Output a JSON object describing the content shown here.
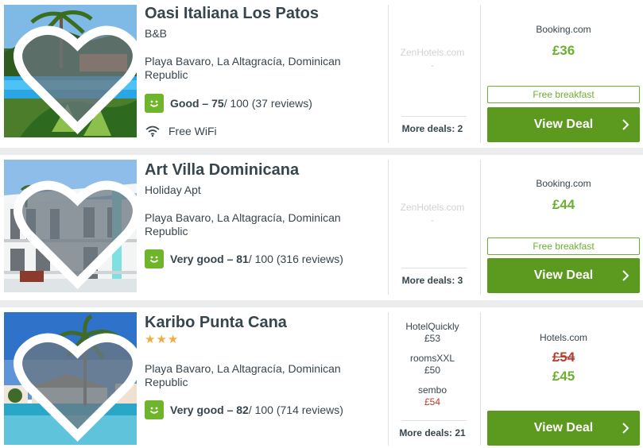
{
  "hotels": [
    {
      "name": "Oasi Italiana Los Patos",
      "type": "B&B",
      "stars": "",
      "address": "Playa Bavaro, La Altagracía, Dominican Republic",
      "rating_label": "Good – 75",
      "rating_rest": " / 100 (37 reviews)",
      "amenity": "Free WiFi",
      "ghost_partner": "ZenHotels.com",
      "ghost_price": "-",
      "more_deals": "More deals: 2",
      "partner": "Booking.com",
      "price": "£36",
      "badge": "Free breakfast",
      "cta": "View Deal"
    },
    {
      "name": "Art Villa Dominicana",
      "type": "Holiday Apt",
      "address": "Playa Bavaro, La Altagracía, Dominican Republic",
      "rating_label": "Very good – 81",
      "rating_rest": " / 100 (316 reviews)",
      "ghost_partner": "ZenHotels.com",
      "ghost_price": "-",
      "more_deals": "More deals: 3",
      "partner": "Booking.com",
      "price": "£44",
      "badge": "Free breakfast",
      "cta": "View Deal"
    },
    {
      "name": "Karibo Punta Cana",
      "stars": "★★★",
      "address": "Playa Bavaro, La Altagracía, Dominican Republic",
      "rating_label": "Very good – 82",
      "rating_rest": " / 100 (714 reviews)",
      "alt_deals": [
        {
          "partner": "HotelQuickly",
          "price": "£53"
        },
        {
          "partner": "roomsXXL",
          "price": "£50"
        },
        {
          "partner": "sembo",
          "price": "£54"
        }
      ],
      "more_deals": "More deals: 21",
      "partner": "Hotels.com",
      "old_price": "£54",
      "price": "£45",
      "cta": "View Deal"
    }
  ],
  "icons": {
    "favorite": "heart-icon",
    "rating": "smiley-icon",
    "wifi": "wifi-icon",
    "cta": "chevron-right-icon"
  },
  "colors": {
    "accent": "#6cb02f",
    "button": "#5b9a1e",
    "strike": "#c0392b",
    "stars": "#f6ab3f"
  }
}
